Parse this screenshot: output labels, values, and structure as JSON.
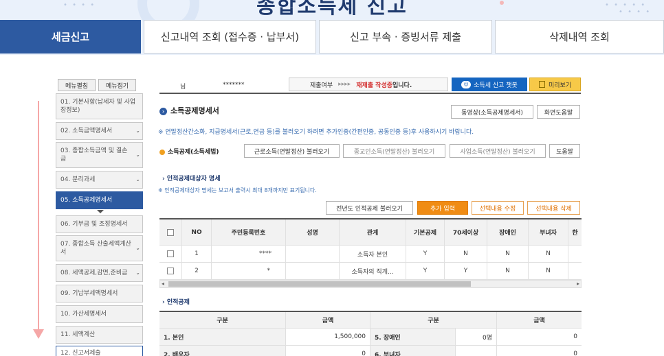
{
  "hero": {
    "title": "종합소득세 신고"
  },
  "main_tabs": [
    {
      "label": "세금신고",
      "active": true
    },
    {
      "label": "신고내역 조회 (접수증 · 납부서)"
    },
    {
      "label": "신고 부속 · 증빙서류 제출"
    },
    {
      "label": "삭제내역 조회"
    }
  ],
  "menu_controls": {
    "expand": "메뉴펼침",
    "collapse": "메뉴접기"
  },
  "side_menu": [
    {
      "label": "01. 기본사항(납세자 및 사업장정보)"
    },
    {
      "label": "02. 소득금액명세서"
    },
    {
      "label": "03. 종합소득금액 및 결손금"
    },
    {
      "label": "04. 분리과세"
    },
    {
      "label": "05. 소득공제명세서",
      "active": true
    },
    {
      "label": "06. 기부금 및 조정명세서"
    },
    {
      "label": "07. 종합소득 산출세액계산서"
    },
    {
      "label": "08. 세액공제,감면,준비금"
    },
    {
      "label": "09. 기납부세액명세서"
    },
    {
      "label": "10. 가산세명세서"
    },
    {
      "label": "11. 세액계산"
    },
    {
      "label": "12. 신고서제출"
    }
  ],
  "info_bar": {
    "name_suffix": "님",
    "masked_id": "*******",
    "submit_status_label": "제출여부",
    "submit_status_arrows": "▸▸▸▸",
    "submit_status_value": "재제출 작성중",
    "submit_status_tail": "입니다.",
    "chatbot_label": "소득세 신고 챗봇",
    "preview_label": "미리보기"
  },
  "section_main": {
    "title": "소득공제명세서",
    "video_help": "동영상(소득공제명세서)",
    "screen_help": "화면도움말",
    "notice": "※ 연말정산간소화, 지급명세서(근로,연금 등)를 불러오기 하려면 추가인증(간편인증, 공동인증 등)후 사용하시기 바랍니다.",
    "subtitle": "소득공제(소득세법)",
    "load_earned": "근로소득(연말정산) 불러오기",
    "load_religious": "종교인소득(연말정산) 불러오기",
    "load_business": "사업소득(연말정산) 불러오기",
    "help": "도움말"
  },
  "dependents": {
    "title": "인적공제대상자 명세",
    "note": "※ 인적공제대상자 명세는 보고서 출력시 최대 8개까지만 표기됩니다.",
    "btn_prev_year": "전년도 인적공제 불러오기",
    "btn_add": "추가 입력",
    "btn_edit": "선택내용 수정",
    "btn_delete": "선택내용 삭제",
    "columns": [
      "NO",
      "주민등록번호",
      "성명",
      "관계",
      "기본공제",
      "70세이상",
      "장애인",
      "부녀자",
      "한"
    ],
    "rows": [
      {
        "no": "1",
        "rrn": "****",
        "name": "",
        "relation": "소득자 본인",
        "basic": "Y",
        "over70": "N",
        "disabled": "N",
        "woman": "N"
      },
      {
        "no": "2",
        "rrn": "*",
        "name": "",
        "relation": "소득자의 직계...",
        "basic": "Y",
        "over70": "Y",
        "disabled": "N",
        "woman": "N"
      }
    ]
  },
  "personal_deduction": {
    "title": "인적공제",
    "columns": [
      "구분",
      "금액",
      "구분",
      "금액"
    ],
    "rows": [
      {
        "l_label": "1. 본인",
        "l_amount": "1,500,000",
        "r_label": "5. 장애인",
        "r_count": "0명",
        "r_amount": "0"
      },
      {
        "l_label": "2. 배우자",
        "l_amount": "0",
        "r_label": "6. 부녀자",
        "r_count": "",
        "r_amount": "0"
      }
    ]
  }
}
